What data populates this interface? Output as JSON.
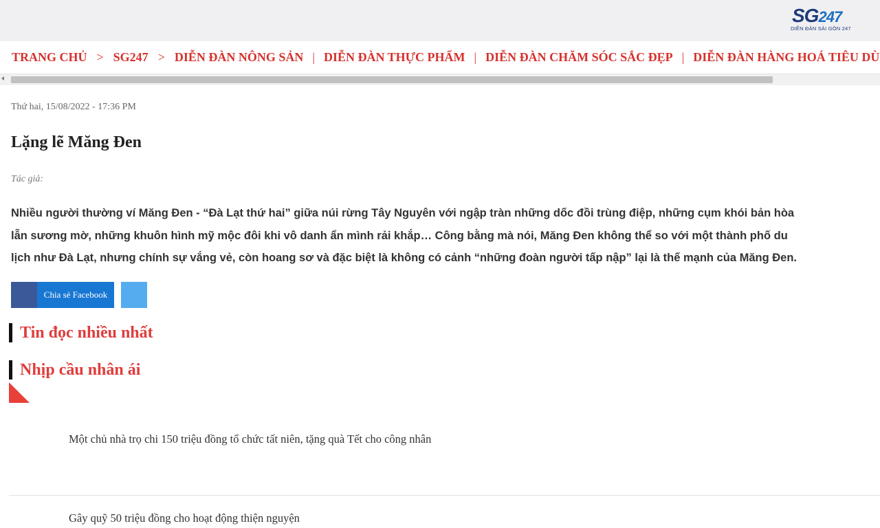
{
  "logo": {
    "text_main": "SG",
    "text_num": "247",
    "subtitle": "DIỄN ĐÀN SÀI GÒN 247"
  },
  "nav": {
    "items": [
      {
        "label": "TRANG CHỦ"
      },
      {
        "label": "SG247"
      },
      {
        "label": "DIỄN ĐÀN NÔNG SẢN"
      },
      {
        "label": "DIỄN ĐÀN THỰC PHẨM"
      },
      {
        "label": "DIỄN ĐÀN CHĂM SÓC SẮC ĐẸP"
      },
      {
        "label": "DIỄN ĐÀN HÀNG HOÁ TIÊU DÙNG"
      }
    ],
    "breadcrumb_separator": ">",
    "pipe_separator": "|"
  },
  "article": {
    "date": "Thứ hai, 15/08/2022 - 17:36 PM",
    "title": "Lặng lẽ Măng Đen",
    "author": "Tác giả:",
    "lead_lines": [
      "Nhiều người thường ví Măng Đen - “Đà Lạt thứ hai” giữa núi rừng Tây Nguyên với ngập tràn những dốc đồi trùng điệp, những cụm khói bản hòa",
      "lẫn sương mờ, những khuôn hình mỹ mộc đôi khi vô danh ẩn mình rải khắp… Công bằng mà nói, Măng Đen không thể so với một thành phố du",
      "lịch như Đà Lạt, nhưng chính sự vắng vẻ, còn hoang sơ và đặc biệt là không có cảnh “những đoàn người tấp nập” lại là thế mạnh của Măng Đen."
    ]
  },
  "share": {
    "facebook_label": "Chia sẻ Facebook",
    "facebook_color": "#1877d3",
    "facebook_icon_color": "#3b5998",
    "twitter_color": "#55acee"
  },
  "sections": {
    "most_read": "Tin đọc nhiều nhất",
    "charity": "Nhịp cầu nhân ái"
  },
  "news": [
    {
      "title": "Một chủ nhà trọ chi 150 triệu đồng tổ chức tất niên, tặng quà Tết cho công nhân"
    },
    {
      "title": "Gây quỹ 50 triệu đồng cho hoạt động thiện nguyện"
    }
  ],
  "colors": {
    "accent_red": "#d4322e",
    "heading_red": "#e03c3c"
  }
}
